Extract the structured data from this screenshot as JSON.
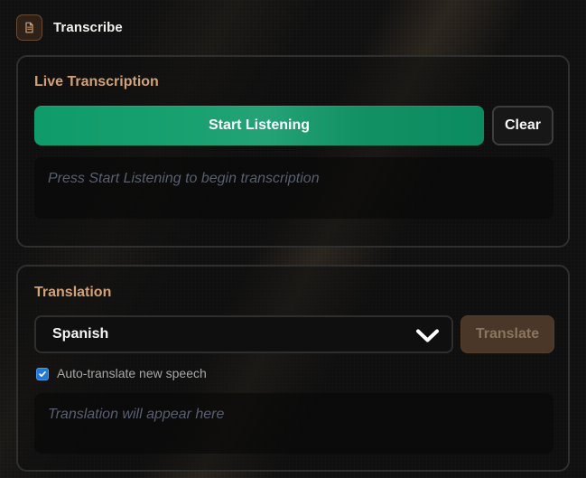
{
  "header": {
    "icon": "document-icon",
    "title": "Transcribe"
  },
  "live": {
    "title": "Live Transcription",
    "start_label": "Start Listening",
    "clear_label": "Clear",
    "placeholder": "Press Start Listening to begin transcription"
  },
  "translation": {
    "title": "Translation",
    "selected_language": "Spanish",
    "translate_label": "Translate",
    "auto_translate_label": "Auto-translate new speech",
    "auto_translate_checked": true,
    "placeholder": "Translation will appear here"
  },
  "colors": {
    "accent": "#d3a176",
    "primary_button": "#16a06f",
    "checkbox": "#1f7ad5"
  }
}
